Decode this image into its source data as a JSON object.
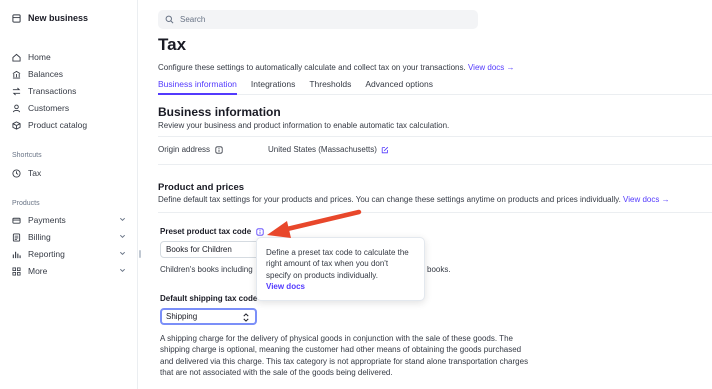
{
  "sidebar": {
    "brand": "New business",
    "nav": [
      {
        "label": "Home",
        "icon": "home-icon"
      },
      {
        "label": "Balances",
        "icon": "balances-icon"
      },
      {
        "label": "Transactions",
        "icon": "transactions-icon"
      },
      {
        "label": "Customers",
        "icon": "customers-icon"
      },
      {
        "label": "Product catalog",
        "icon": "product-catalog-icon"
      }
    ],
    "shortcuts_label": "Shortcuts",
    "shortcuts": [
      {
        "label": "Tax",
        "icon": "tax-icon"
      }
    ],
    "products_label": "Products",
    "products": [
      {
        "label": "Payments",
        "icon": "payments-icon"
      },
      {
        "label": "Billing",
        "icon": "billing-icon"
      },
      {
        "label": "Reporting",
        "icon": "reporting-icon"
      },
      {
        "label": "More",
        "icon": "more-icon"
      }
    ]
  },
  "search": {
    "placeholder": "Search"
  },
  "page": {
    "title": "Tax",
    "subtitle": "Configure these settings to automatically calculate and collect tax on your transactions.",
    "subtitle_link": "View docs →"
  },
  "tabs": [
    "Business information",
    "Integrations",
    "Thresholds",
    "Advanced options"
  ],
  "business": {
    "heading": "Business information",
    "description": "Review your business and product information to enable automatic tax calculation.",
    "origin_label": "Origin address",
    "origin_value": "United States (Massachusetts)"
  },
  "products_prices": {
    "heading": "Product and prices",
    "description": "Define default tax settings for your products and prices. You can change these settings anytime on products and prices individually.",
    "link": "View docs →",
    "preset_label": "Preset product tax code",
    "preset_value": "Books for Children",
    "preset_help_start": "Children's books including",
    "preset_help_end": "books.",
    "shipping_label": "Default shipping tax code",
    "shipping_value": "Shipping",
    "shipping_help": [
      "A shipping charge for the delivery of physical goods in conjunction with the sale of these goods. The",
      "shipping charge is optional, meaning the customer had other means of obtaining the goods purchased",
      "and delivered via this charge. This tax category is not appropriate for stand alone transportation charges",
      "that are not associated with the sale of the goods being delivered."
    ]
  },
  "tooltip": {
    "lines": [
      "Define a preset tax code to calculate the",
      "right amount of tax when you don't",
      "specify on products individually."
    ],
    "link": "View docs"
  },
  "colors": {
    "accent": "#533afd",
    "annotation_arrow": "#e8472b"
  }
}
